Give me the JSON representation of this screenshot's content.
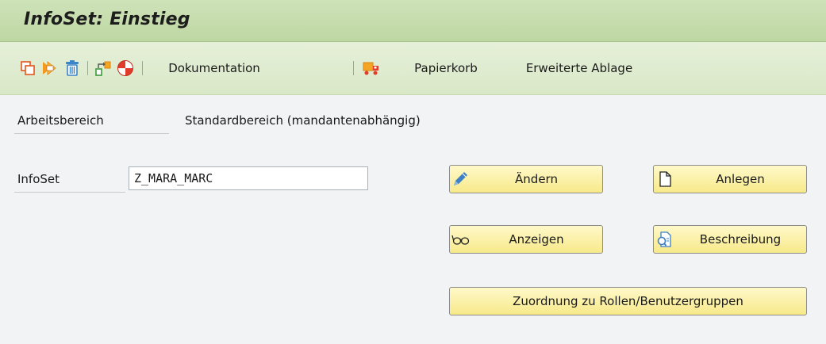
{
  "window": {
    "title": "InfoSet: Einstieg"
  },
  "toolbar": {
    "items": [
      {
        "icon": "copy-icon"
      },
      {
        "icon": "rename-icon"
      },
      {
        "icon": "delete-icon"
      },
      {
        "icon": "transport-icon"
      },
      {
        "icon": "check-icon"
      },
      {
        "label": "Dokumentation"
      },
      {
        "icon": "trash-truck-icon"
      },
      {
        "label": "Papierkorb"
      },
      {
        "label": "Erweiterte Ablage"
      }
    ]
  },
  "form": {
    "workspace_label": "Arbeitsbereich",
    "workspace_value": "Standardbereich (mandantenabhängig)",
    "infoset_label": "InfoSet",
    "infoset_value": "Z_MARA_MARC"
  },
  "buttons": {
    "change": "Ändern",
    "create": "Anlegen",
    "display": "Anzeigen",
    "description": "Beschreibung",
    "assign_roles": "Zuordnung zu Rollen/Benutzergruppen"
  },
  "colors": {
    "title_bar": "#c5dcab",
    "toolbar": "#dfecd0",
    "background": "#f2f3f4",
    "button": "#f9ec9b",
    "pencil_blue": "#3f7fc4",
    "orange": "#f08a24",
    "red": "#e03c2b"
  }
}
